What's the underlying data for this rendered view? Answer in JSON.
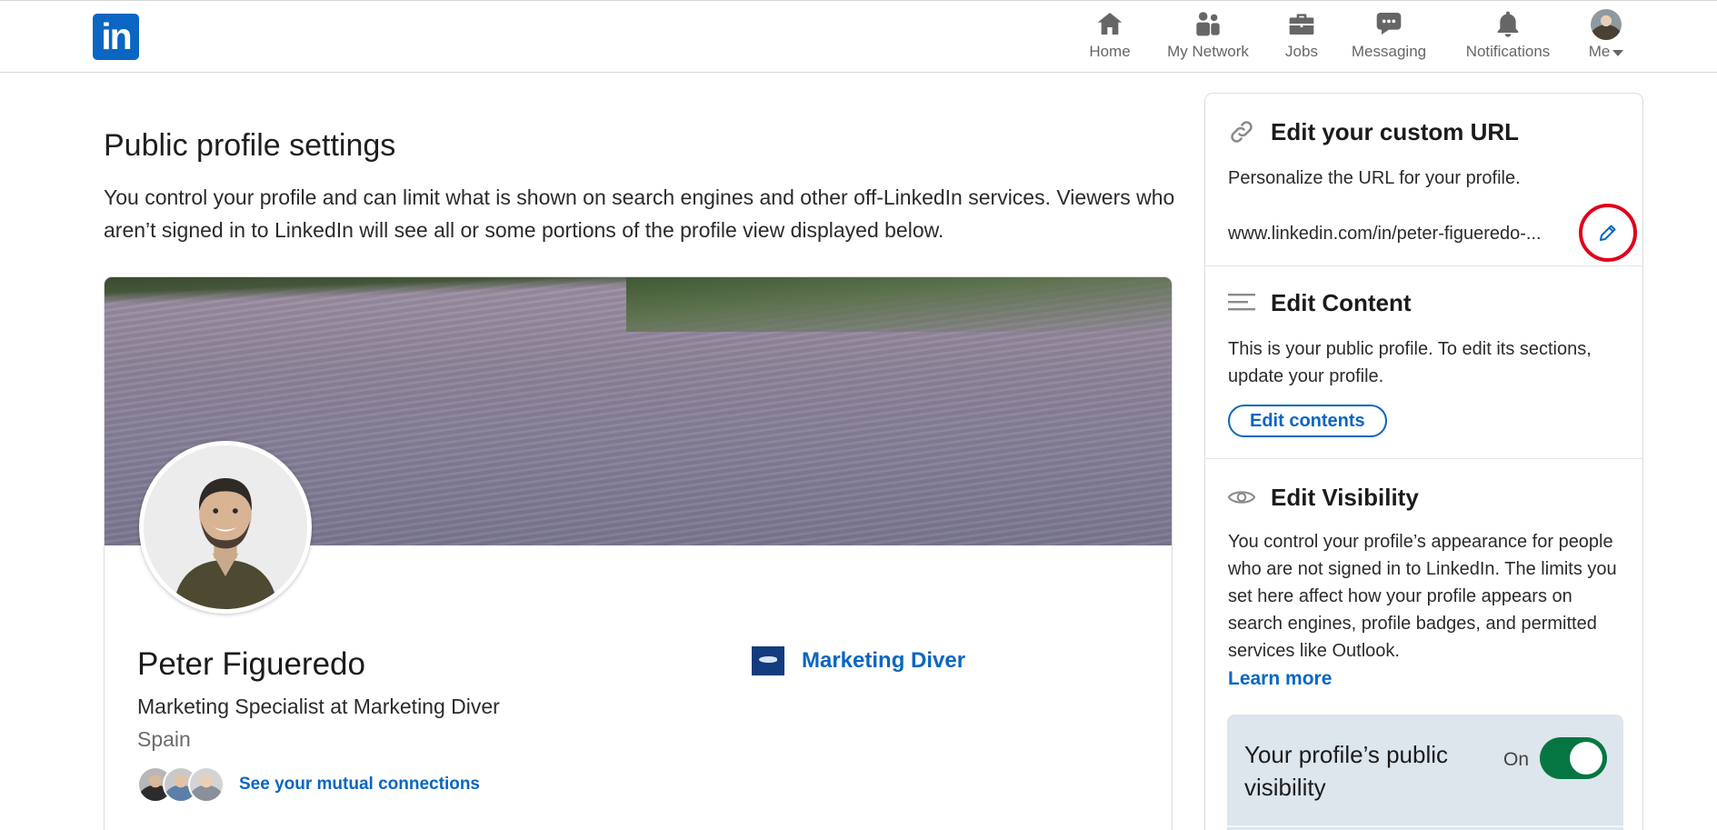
{
  "nav": {
    "logo_text": "in",
    "items": [
      {
        "label": "Home",
        "icon": "home-icon"
      },
      {
        "label": "My Network",
        "icon": "network-icon"
      },
      {
        "label": "Jobs",
        "icon": "briefcase-icon"
      },
      {
        "label": "Messaging",
        "icon": "messaging-icon"
      },
      {
        "label": "Notifications",
        "icon": "bell-icon"
      },
      {
        "label": "Me",
        "icon": "avatar"
      }
    ]
  },
  "main": {
    "title": "Public profile settings",
    "description": "You control your profile and can limit what is shown on search engines and other off-LinkedIn services. Viewers who aren’t signed in to LinkedIn will see all or some portions of the profile view displayed below."
  },
  "profile": {
    "name": "Peter Figueredo",
    "headline": "Marketing Specialist at Marketing Diver",
    "location": "Spain",
    "mutual_link": "See your mutual connections",
    "company": "Marketing Diver"
  },
  "sidebar": {
    "url_section": {
      "title": "Edit your custom URL",
      "text": "Personalize the URL for your profile.",
      "url": "www.linkedin.com/in/peter-figueredo-..."
    },
    "content_section": {
      "title": "Edit Content",
      "text": "This is your public profile. To edit its sections, update your profile.",
      "button": "Edit contents"
    },
    "visibility_section": {
      "title": "Edit Visibility",
      "text": "You control your profile’s appearance for people who are not signed in to LinkedIn. The limits you set here affect how your profile appears on search engines, profile badges, and permitted services like Outlook.",
      "link": "Learn more",
      "toggle_label": "Your profile’s public visibility",
      "toggle_state": "On"
    }
  },
  "colors": {
    "brand": "#0a66c2",
    "toggle_on": "#057642",
    "highlight_ring": "#e0001b"
  }
}
